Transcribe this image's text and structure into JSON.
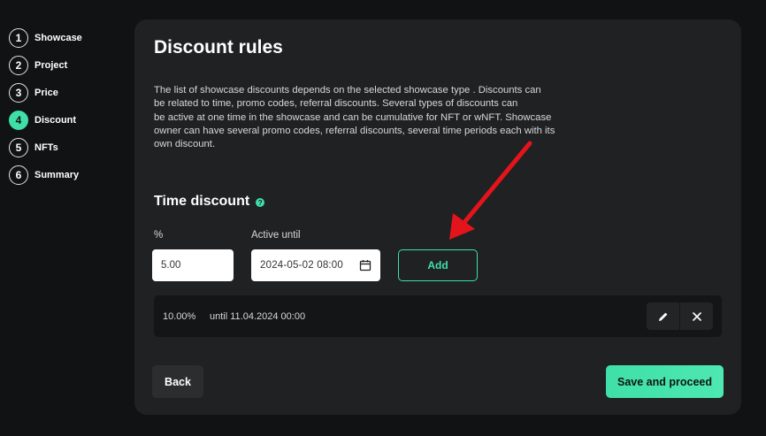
{
  "steps": [
    {
      "num": "1",
      "label": "Showcase"
    },
    {
      "num": "2",
      "label": "Project"
    },
    {
      "num": "3",
      "label": "Price"
    },
    {
      "num": "4",
      "label": "Discount"
    },
    {
      "num": "5",
      "label": "NFTs"
    },
    {
      "num": "6",
      "label": "Summary"
    }
  ],
  "active_step": "Discount",
  "page": {
    "title": "Discount rules",
    "description_lines": [
      "The list of  showcase discounts depends on  the selected showcase type . Discounts can",
      "be  related to time, promo codes, referral discounts. Several types of discounts can",
      "be  active at one time in  the showcase and can be  cumulative for NFT or  wNFT. Showcase",
      "owner can have several promo codes, referral discounts, several time periods each with its",
      "own discount."
    ]
  },
  "time_discount": {
    "title": "Time discount",
    "help_icon": "?",
    "percent_label": "%",
    "percent_value": "5.00",
    "active_until_label": "Active until",
    "active_until_value": "2024-05-02 08:00",
    "add_label": "Add"
  },
  "discounts": [
    {
      "percent": "10.00%",
      "until": "until 11.04.2024 00:00"
    }
  ],
  "footer": {
    "back_label": "Back",
    "save_label": "Save and proceed"
  },
  "colors": {
    "accent": "#3fe0a8",
    "annotation_arrow": "#e3141b"
  }
}
